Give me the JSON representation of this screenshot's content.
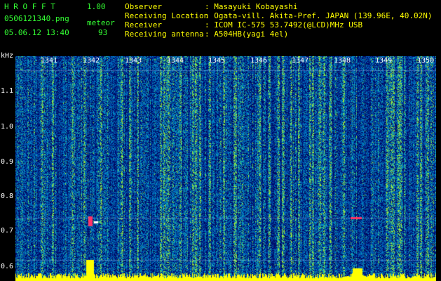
{
  "header": {
    "app_name": "H R O F F T",
    "version": "1.00",
    "filename": "0506121340.png",
    "datetime": "05.06.12 13:40",
    "mode_label": "meteor",
    "count": "93"
  },
  "info": [
    {
      "key": "Observer",
      "value": ": Masayuki Kobayashi"
    },
    {
      "key": "Receiving Location",
      "value": ": Ogata-vill. Akita-Pref. JAPAN (139.96E, 40.02N)"
    },
    {
      "key": "Receiver",
      "value": ": ICOM IC-575 53.7492(@LCD)MHz USB"
    },
    {
      "key": "Receiving antenna",
      "value": ": A504HB(yagi 4el)"
    }
  ],
  "y_axis": {
    "unit": "kHz",
    "ticks": [
      "1.1",
      "1.0",
      "0.9",
      "0.8",
      "0.7",
      "0.6"
    ]
  },
  "x_axis": {
    "ticks": [
      "1341",
      "1342",
      "1343",
      "1344",
      "1345",
      "1346",
      "1347",
      "1348",
      "1349",
      "1350"
    ]
  },
  "colors": {
    "background": "#000000",
    "header_green": "#33ff33",
    "header_yellow": "#ffff00",
    "spectrogram_base": "#000a4a"
  }
}
